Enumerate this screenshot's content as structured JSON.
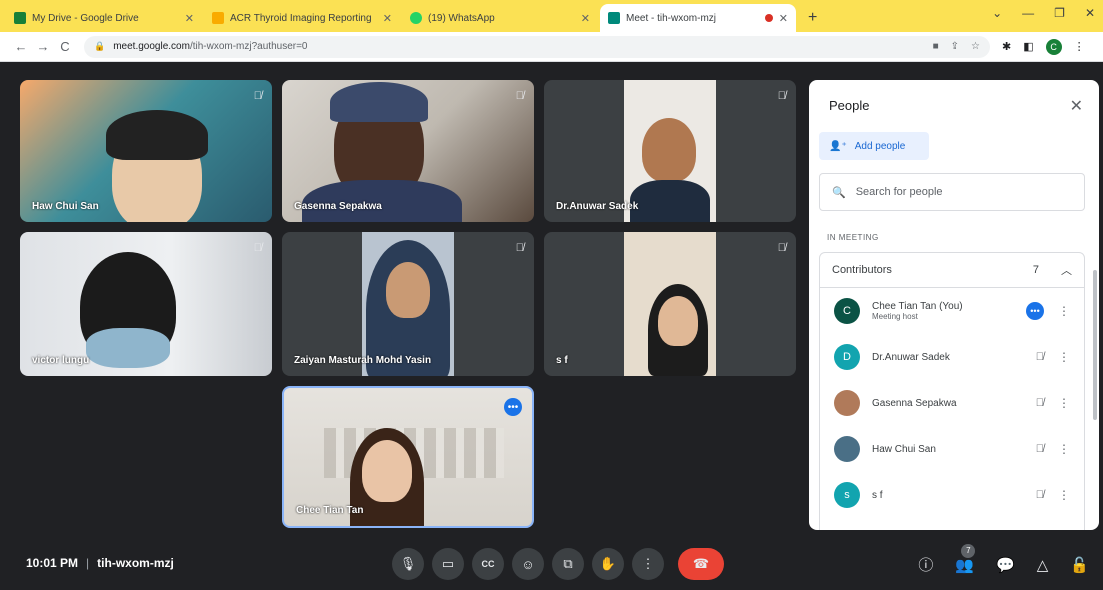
{
  "browser": {
    "tabs": [
      {
        "title": "My Drive - Google Drive",
        "favicon_color": "#188038",
        "active": false
      },
      {
        "title": "ACR Thyroid Imaging Reporting",
        "favicon_color": "#f9ab00",
        "active": false
      },
      {
        "title": "(19) WhatsApp",
        "favicon_color": "#25d366",
        "active": false
      },
      {
        "title": "Meet - tih-wxom-mzj",
        "favicon_color": "#00897b",
        "active": true
      }
    ],
    "new_tab_label": "+",
    "url_host": "meet.google.com",
    "url_path": "/tih-wxom-mzj?authuser=0",
    "profile_initial": "C"
  },
  "tiles": [
    {
      "name": "Haw Chui San",
      "muted": true
    },
    {
      "name": "Gasenna Sepakwa",
      "muted": true
    },
    {
      "name": "Dr.Anuwar Sadek",
      "muted": true
    },
    {
      "name": "victor lungu",
      "muted": true
    },
    {
      "name": "Zaiyan Masturah Mohd Yasin",
      "muted": true
    },
    {
      "name": "s f",
      "muted": true
    },
    {
      "name": "Chee Tian Tan",
      "muted": false,
      "speaking": true
    }
  ],
  "panel": {
    "title": "People",
    "add_people_label": "Add people",
    "search_placeholder": "Search for people",
    "section_label": "IN MEETING",
    "group_label": "Contributors",
    "group_count": "7",
    "participants": [
      {
        "initial": "C",
        "name": "Chee Tian Tan (You)",
        "subtitle": "Meeting host",
        "avatar_color": "#0b5345",
        "status": "active"
      },
      {
        "initial": "D",
        "name": "Dr.Anuwar Sadek",
        "subtitle": "",
        "avatar_color": "#12a4af",
        "status": "muted"
      },
      {
        "initial": "",
        "name": "Gasenna Sepakwa",
        "subtitle": "",
        "avatar_color": "#b07a5a",
        "status": "muted"
      },
      {
        "initial": "",
        "name": "Haw Chui San",
        "subtitle": "",
        "avatar_color": "#4a6f86",
        "status": "muted"
      },
      {
        "initial": "s",
        "name": "s f",
        "subtitle": "",
        "avatar_color": "#12a4af",
        "status": "muted"
      }
    ]
  },
  "bottom": {
    "time": "10:01 PM",
    "meeting_code": "tih-wxom-mzj",
    "people_count": "7"
  }
}
